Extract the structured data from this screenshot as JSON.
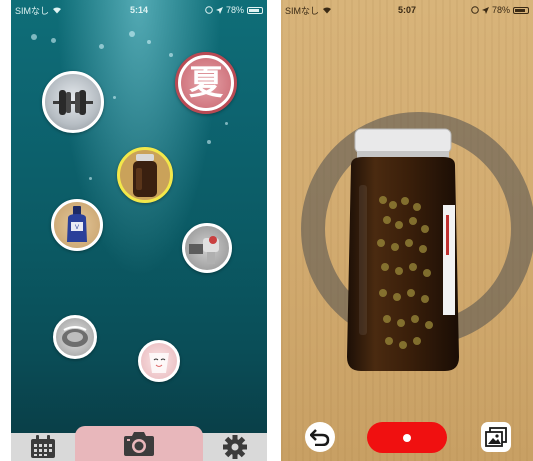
{
  "left_screen": {
    "status": {
      "carrier": "SIMなし",
      "time": "5:14",
      "battery": "78%"
    },
    "memo_bubbles": [
      {
        "name": "memo-bubble-dumbbell",
        "subject": "dumbbell photo"
      },
      {
        "name": "memo-bubble-stamp",
        "subject": "stamp",
        "label": "夏",
        "color": "#b94a54"
      },
      {
        "name": "memo-bubble-jar",
        "subject": "amber jar photo",
        "selected": true
      },
      {
        "name": "memo-bubble-bottle",
        "subject": "blue bottle photo"
      },
      {
        "name": "memo-bubble-faucet",
        "subject": "faucet photo"
      },
      {
        "name": "memo-bubble-sink",
        "subject": "sink photo"
      },
      {
        "name": "memo-bubble-cup",
        "subject": "cup photo"
      }
    ],
    "tab_bar": {
      "items": [
        {
          "name": "calendar",
          "icon": "calendar-icon"
        },
        {
          "name": "camera",
          "icon": "camera-icon",
          "active": true
        },
        {
          "name": "settings",
          "icon": "gear-icon"
        }
      ],
      "active_color": "#e8b7bb",
      "bar_color": "#d9d9d9"
    }
  },
  "right_screen": {
    "status": {
      "carrier": "SIMなし",
      "time": "5:07",
      "battery": "78%"
    },
    "toolbar": {
      "back_icon": "undo-icon",
      "shutter_color": "#f01010",
      "gallery_icon": "image-gallery-icon"
    }
  }
}
